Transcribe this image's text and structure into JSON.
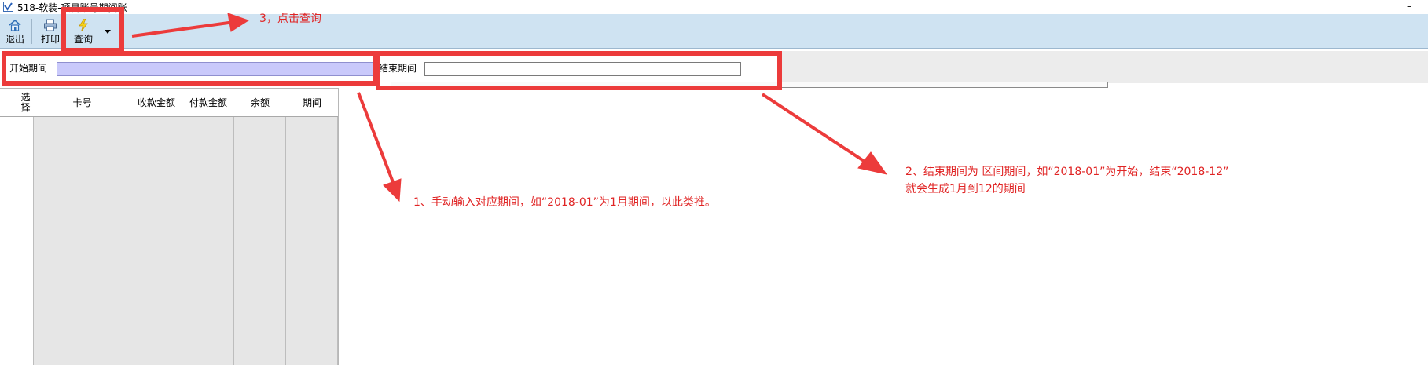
{
  "window": {
    "title": "518-软装-项目账号期间账",
    "minimize_glyph": "–"
  },
  "toolbar": {
    "exit_label": "退出",
    "print_label": "打印",
    "query_label": "查询"
  },
  "filter": {
    "start_label": "开始期间",
    "start_value": "",
    "end_label": "结束期间",
    "end_value": ""
  },
  "grid": {
    "headers": [
      "选择",
      "卡号",
      "收款金额",
      "付款金额",
      "余额",
      "期间"
    ]
  },
  "annotations": {
    "step3": "3，点击查询",
    "step1": "1、手动输入对应期间，如“2018-01”为1月期间，以此类推。",
    "step2_line1": "2、结束期间为 区间期间，如“2018-01”为开始，结束“2018-12”",
    "step2_line2": "就会生成1月到12的期间"
  },
  "colors": {
    "toolbar_bg": "#cfe3f2",
    "start_field_bg": "#c9c9fb",
    "annotation_red": "#ec3b3b",
    "grid_shade": "#e6e6e6"
  },
  "icons": {
    "app": "app-logo-icon",
    "exit": "home-icon",
    "print": "printer-icon",
    "query": "lightning-icon",
    "dropdown": "dropdown-arrow-icon"
  }
}
